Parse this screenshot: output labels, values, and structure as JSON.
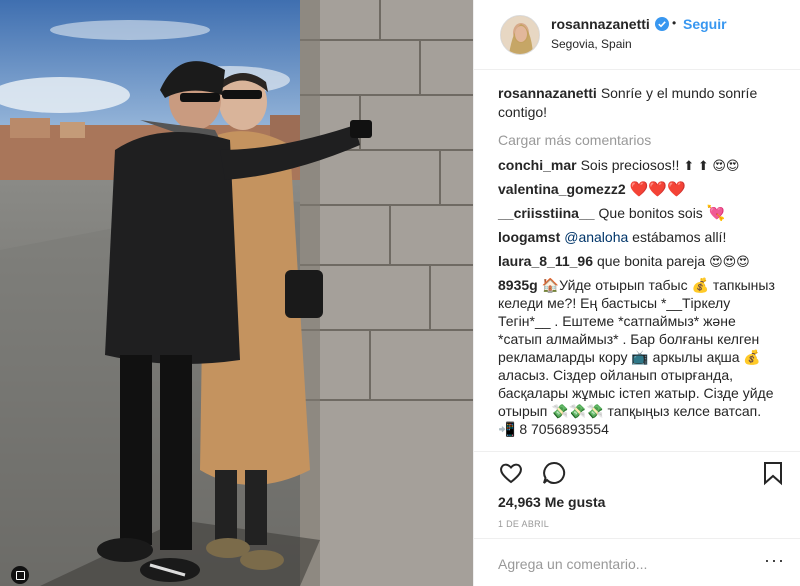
{
  "post": {
    "username": "rosannazanetti",
    "follow_label": "Seguir",
    "location": "Segovia, Spain",
    "dot": "•",
    "caption": "Sonríe y el mundo sonríe contigo!",
    "load_more": "Cargar más comentarios",
    "likes": "24,963 Me gusta",
    "date": "1 DE ABRIL",
    "comment_placeholder": "Agrega un comentario...",
    "more_options": "···"
  },
  "comments": [
    {
      "user": "conchi_mar",
      "text": "Sois preciosos!!",
      "emoji": "⬆ ⬆ 😍😍"
    },
    {
      "user": "valentina_gomezz2",
      "text": "",
      "emoji": "❤️❤️❤️"
    },
    {
      "user": "__criisstiina__",
      "text": "Que bonitos sois",
      "emoji": "💘"
    },
    {
      "user": "loogamst",
      "mention": "@analoha",
      "text": "estábamos allí!"
    },
    {
      "user": "laura_8_11_96",
      "text": "que bonita pareja",
      "emoji": "😍😍😍"
    },
    {
      "user": "8935g",
      "text": "🏠Уйде отырып табыс 💰 тапкыныз келеди ме?! Ең бастысы *__Тіркелу Тегін*__ . Ештеме *сатпаймыз* және *сатып алмаймыз* . Бар болғаны келген рекламаларды кору 📺 аркылы ақша 💰 аласыз. Сіздер ойланып отырғанда, басқалары жұмыс істеп жатыр. Сізде уйде отырып 💸💸💸 тапқыңыз келсе ватсап. 📲 8 7056893554"
    }
  ],
  "icons": {
    "verified": "verified-badge-icon",
    "like": "heart-icon",
    "comment": "comment-icon",
    "save": "bookmark-icon",
    "stack": "multi-photo-icon"
  },
  "colors": {
    "accent": "#3897f0",
    "text": "#262626",
    "muted": "#999999",
    "border": "#efefef"
  }
}
